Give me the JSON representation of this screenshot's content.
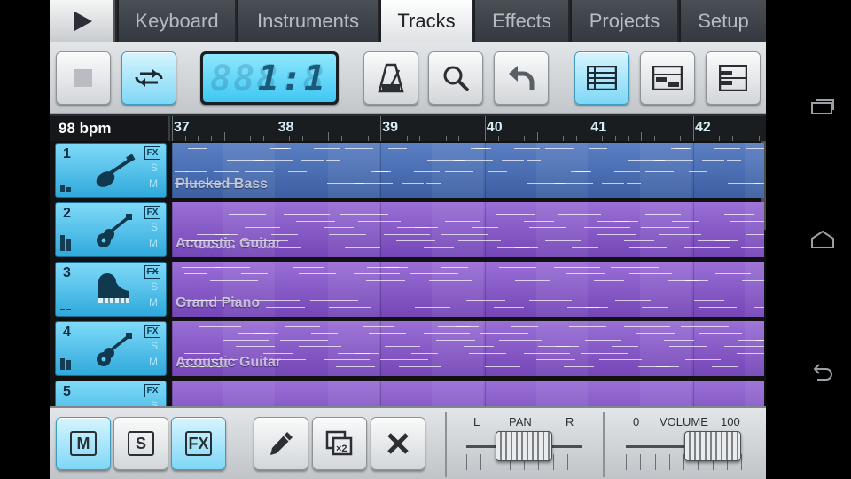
{
  "nav": {
    "tabs": [
      "Keyboard",
      "Instruments",
      "Tracks",
      "Effects",
      "Projects",
      "Setup"
    ],
    "active_tab": "Tracks"
  },
  "toolbar": {
    "lcd_position": "1:1",
    "lcd_ghost": "888:8"
  },
  "timeline": {
    "bpm": "98 bpm",
    "bars": [
      "37",
      "38",
      "39",
      "40",
      "41",
      "42"
    ]
  },
  "tracks": [
    {
      "number": "1",
      "name": "Plucked Bass",
      "instrument_icon": "bass-guitar-icon",
      "color": "blue",
      "fx_active": true,
      "level": 0.3
    },
    {
      "number": "2",
      "name": "Acoustic Guitar",
      "instrument_icon": "acoustic-guitar-icon",
      "color": "purple",
      "fx_active": false,
      "level": 0.8
    },
    {
      "number": "3",
      "name": "Grand Piano",
      "instrument_icon": "grand-piano-icon",
      "color": "purple",
      "fx_active": true,
      "level": 0.1
    },
    {
      "number": "4",
      "name": "Acoustic Guitar",
      "instrument_icon": "acoustic-guitar-icon",
      "color": "purple",
      "fx_active": false,
      "level": 0.6
    },
    {
      "number": "5",
      "name": "",
      "instrument_icon": "",
      "color": "purple",
      "fx_active": false,
      "level": 0.0
    }
  ],
  "track_controls": {
    "fx": "FX",
    "solo": "S",
    "mute": "M"
  },
  "bottom": {
    "mute_label": "M",
    "solo_label": "S",
    "fx_label": "FX",
    "pan_label": "PAN",
    "pan_left": "L",
    "pan_right": "R",
    "volume_label": "VOLUME",
    "volume_min": "0",
    "volume_max": "100",
    "pan_value": 0.5,
    "volume_value": 0.75
  },
  "colors": {
    "accent_cyan": "#6ed2f5",
    "track_blue": "#4b6fb3",
    "track_purple": "#8a5cc9"
  }
}
